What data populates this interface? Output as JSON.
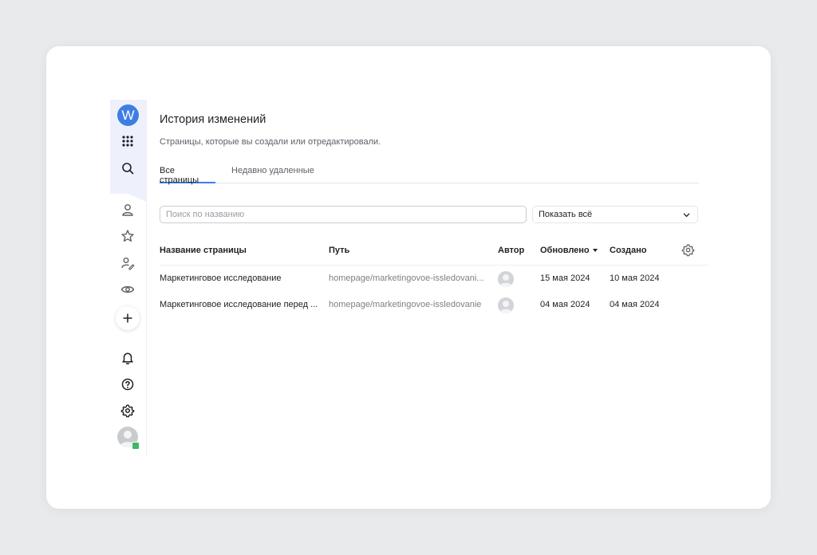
{
  "sidebar": {
    "logo_letter": "W",
    "icons": [
      "apps-grid-icon",
      "search-icon",
      "user-icon",
      "star-icon",
      "edit-user-icon",
      "eye-icon",
      "plus-icon",
      "bell-icon",
      "help-icon",
      "gear-icon"
    ]
  },
  "page": {
    "title": "История изменений",
    "subtitle": "Страницы, которые вы создали или отредактировали."
  },
  "tabs": [
    {
      "label": "Все страницы",
      "active": true
    },
    {
      "label": "Недавно удаленные",
      "active": false
    }
  ],
  "filters": {
    "search_placeholder": "Поиск по названию",
    "select_value": "Показать всё"
  },
  "table": {
    "columns": {
      "name": "Название страницы",
      "path": "Путь",
      "author": "Автор",
      "updated": "Обновлено",
      "created": "Создано"
    },
    "rows": [
      {
        "name": "Маркетинговое исследование",
        "path": "homepage/marketingovoe-issledovani...",
        "updated": "15 мая 2024",
        "created": "10 мая 2024"
      },
      {
        "name": "Маркетинговое исследование перед ...",
        "path": "homepage/marketingovoe-issledovanie",
        "updated": "04 мая 2024",
        "created": "04 мая 2024"
      }
    ]
  },
  "colors": {
    "accent": "#3f7de6",
    "sidebar_top_bg": "#eef1fb",
    "status_badge": "#3fb86b"
  }
}
